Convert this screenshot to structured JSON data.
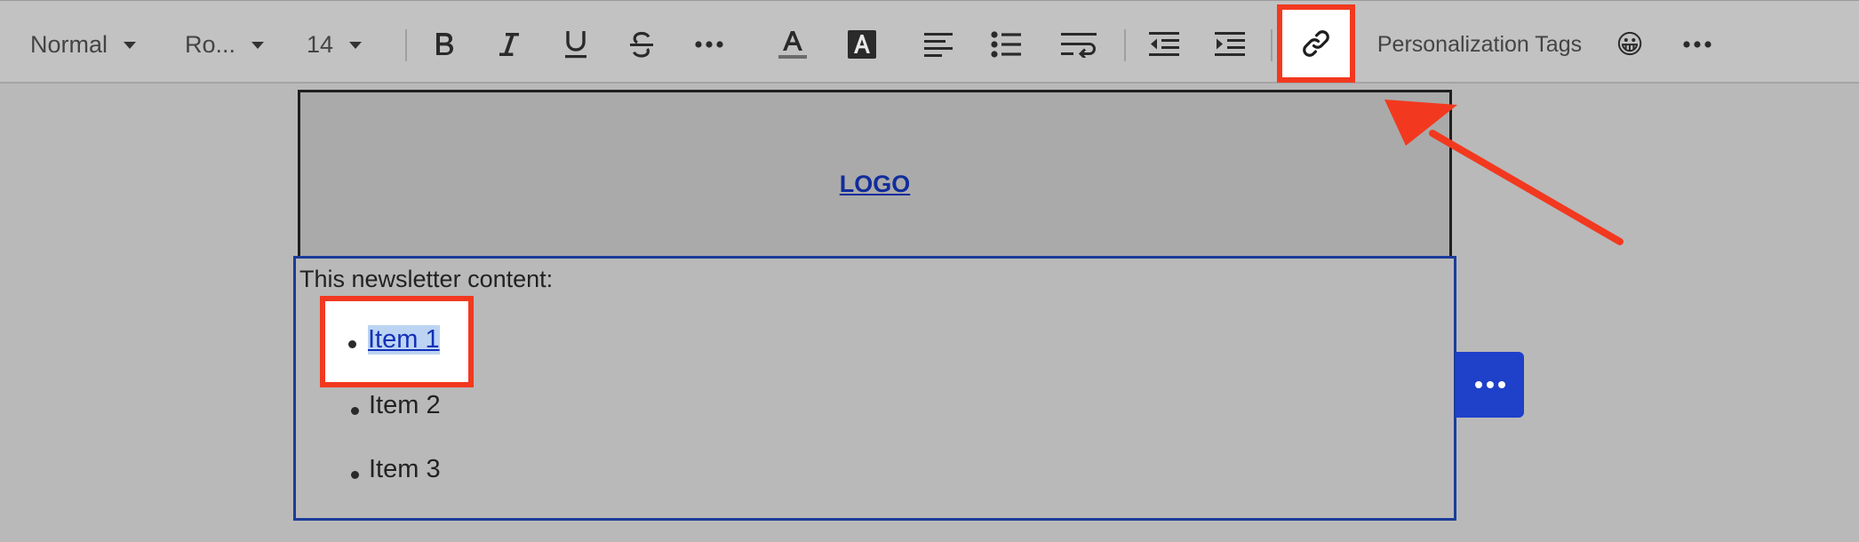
{
  "toolbar": {
    "style_value": "Normal",
    "font_value": "Ro...",
    "size_value": "14",
    "personalization_label": "Personalization Tags",
    "emoji": "😀"
  },
  "content": {
    "logo_text": "LOGO",
    "intro_text": "This newsletter content:",
    "items": [
      "Item 1",
      "Item 2",
      "Item 3"
    ]
  },
  "icons": {
    "bold": "bold-icon",
    "italic": "italic-icon",
    "underline": "underline-icon",
    "strikethrough": "strikethrough-icon",
    "more_format": "more-horizontal-icon",
    "text_color": "text-color-icon",
    "highlight": "highlight-color-icon",
    "align": "align-left-icon",
    "list": "bulleted-list-icon",
    "wrap": "text-wrap-icon",
    "outdent": "outdent-icon",
    "indent": "indent-icon",
    "link": "link-icon",
    "emoji": "emoji-icon",
    "overflow": "more-horizontal-icon"
  },
  "colors": {
    "annotation": "#f2391f",
    "accent_blue": "#1f40c8",
    "link_blue": "#1330b8",
    "selection": "#bcd4f2"
  }
}
